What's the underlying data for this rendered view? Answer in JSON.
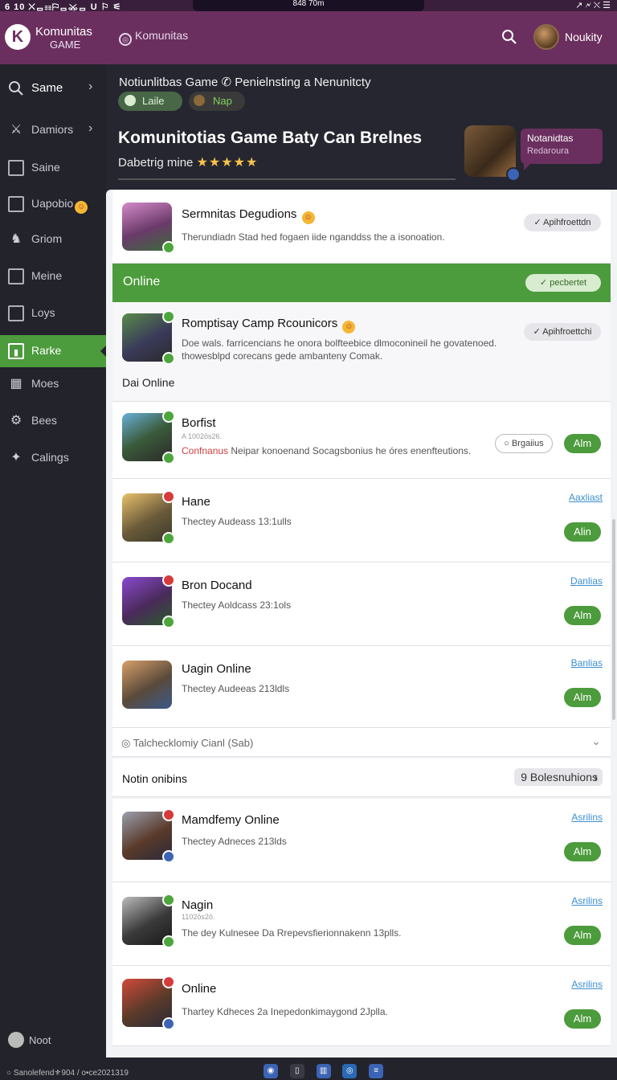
{
  "status": {
    "left": "6 10 ⛌ᆷ☷⚐ᆷ⚔ᆷ U ⚐ ⚟",
    "center": "848 70m",
    "right": "↗ 🗲 ⛌ ☰"
  },
  "topbar": {
    "app_name": "Komunitas",
    "app_sub": "GAME",
    "nav_label": "Komunitas",
    "username": "Noukity"
  },
  "sidebar": {
    "items": [
      {
        "label": "Same"
      },
      {
        "label": "Damiors"
      },
      {
        "label": "Saine"
      },
      {
        "label": "Uapobio"
      },
      {
        "label": "Griom"
      },
      {
        "label": "Meine"
      },
      {
        "label": "Loys"
      },
      {
        "label": "Rarke"
      },
      {
        "label": "Moes"
      },
      {
        "label": "Bees"
      },
      {
        "label": "Calings"
      }
    ],
    "footer": "Noot"
  },
  "header": {
    "breadcrumb": "Notiunlitbas Game ✆ Penielnsting a Nenunitcty",
    "chip_left": "Laile",
    "chip_right": "Nap",
    "title": "Komunitotias Game Baty Can Brelnes",
    "subtitle": "Dabetrig mine",
    "rating": "★★★★★",
    "tooltip_title": "Notanidtas",
    "tooltip_sub": "Redaroura"
  },
  "cards": {
    "top": {
      "title": "Sermnitas Degudions",
      "desc": "Therundiadn Stad hed fogaen iide nganddss the a isonoation.",
      "approve": "✓ Apihfroettdn"
    },
    "online_bar": {
      "label": "Online",
      "pill": "✓ pecbertet"
    },
    "featured": {
      "title": "Romptisay Camp Rcounicors",
      "desc1": "Doe wals. farricencians he onora bolfteebice dlmoconineil he govatenoed.",
      "desc2": "thowesblpd corecans gede ambanteny Comak.",
      "approve": "✓ Apihfroettchi",
      "section": "Dai Online"
    },
    "list": [
      {
        "title": "Borfist",
        "small": "A 1002ōs26.",
        "desc_red": "Confnanus",
        "desc": " Neipar konoenand Socagsbonius he óres enenfteutions.",
        "outline": "○ Brgaiius",
        "btn": "Alm"
      },
      {
        "title": "Hane",
        "desc": "Thectey Audeass 13:1ulls",
        "link": "Aaxliast",
        "btn": "Alin"
      },
      {
        "title": "Bron Docand",
        "desc": "Thectey Aoldcass 23:1ols",
        "link": "Danlias",
        "btn": "Alm"
      },
      {
        "title": "Uagin Online",
        "desc": "Thectey Audeeas 213ldls",
        "link": "Banlias",
        "btn": "Alm"
      }
    ],
    "collapse": "◎ Talchecklomiy Cianl (Sab)",
    "notin": {
      "label": "Notin onibins",
      "button": "9 Bolesnuhions"
    },
    "list2": [
      {
        "title": "Mamdfemy Online",
        "desc": "Thectey Adneces 213lds",
        "link": "Asrilins",
        "btn": "Alm"
      },
      {
        "title": "Nagin",
        "small": "1102ōs2ō.",
        "desc": "The dey Kulnesee Da Rrepevsfierionnakenn 13plls.",
        "link": "Asrilins",
        "btn": "Alm"
      },
      {
        "title": "Online",
        "desc": "Thartey Kdheces 2a Inepedonkimaygond 2Jplla.",
        "link": "Asrilins",
        "btn": "Alm"
      }
    ]
  },
  "footer": {
    "text": "○ Sanolefend⚜904 / o•ce2021319"
  },
  "colors": {
    "accent_purple": "#6b2f5f",
    "accent_green": "#4c9b3c",
    "sidebar_bg": "#23232c",
    "link_blue": "#3c8fd0"
  },
  "icons": [
    "search-icon",
    "avatar",
    "compass-icon",
    "gear-icon",
    "grid-icon",
    "chevron-right-icon",
    "checkmark-icon"
  ]
}
